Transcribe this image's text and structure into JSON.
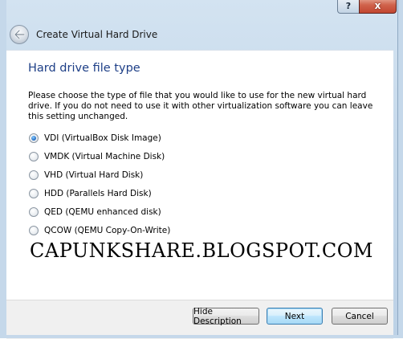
{
  "window": {
    "title": "Create Virtual Hard Drive",
    "help_label": "?",
    "close_label": "x"
  },
  "page": {
    "heading": "Hard drive file type",
    "description": "Please choose the type of file that you would like to use for the new virtual hard drive. If you do not need to use it with other virtualization software you can leave this setting unchanged."
  },
  "options": [
    {
      "label": "VDI (VirtualBox Disk Image)",
      "checked": true
    },
    {
      "label": "VMDK (Virtual Machine Disk)",
      "checked": false
    },
    {
      "label": "VHD (Virtual Hard Disk)",
      "checked": false
    },
    {
      "label": "HDD (Parallels Hard Disk)",
      "checked": false
    },
    {
      "label": "QED (QEMU enhanced disk)",
      "checked": false
    },
    {
      "label": "QCOW (QEMU Copy-On-Write)",
      "checked": false
    }
  ],
  "watermark": "CAPUNKSHARE.BLOGSPOT.COM",
  "buttons": {
    "hide_description": "Hide Description",
    "next": "Next",
    "cancel": "Cancel"
  },
  "colors": {
    "heading": "#1e3f87",
    "close_button": "#c24630",
    "default_button_border": "#3c7fb1"
  }
}
